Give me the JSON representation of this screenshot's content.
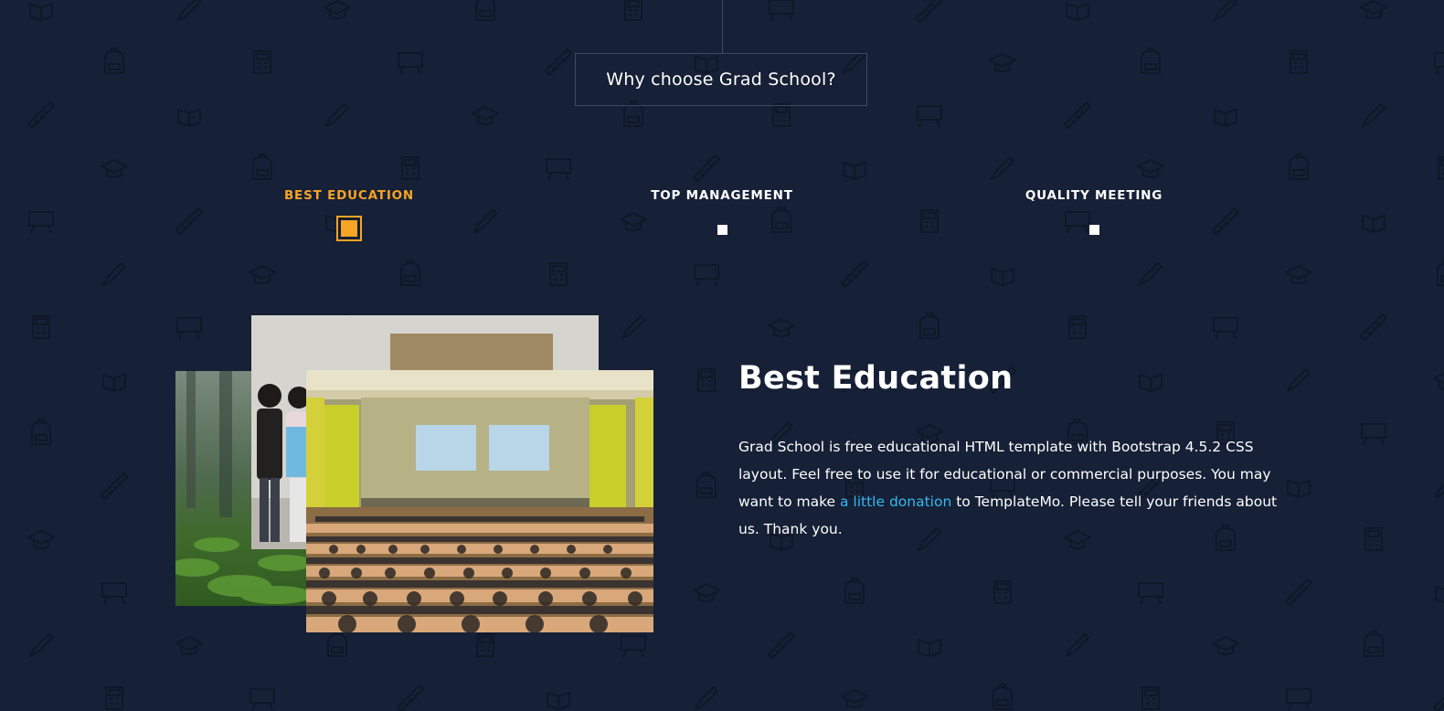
{
  "section": {
    "title": "Why choose Grad School?"
  },
  "tabs": [
    {
      "label": "BEST EDUCATION",
      "active": true
    },
    {
      "label": "TOP MANAGEMENT",
      "active": false
    },
    {
      "label": "QUALITY MEETING",
      "active": false
    }
  ],
  "content": {
    "title": "Best Education",
    "text_before_link": "Grad School is free educational HTML template with Bootstrap 4.5.2 CSS layout. Feel free to use it for educational or commercial purposes. You may want to make ",
    "link_text": "a little donation",
    "text_after_link": " to TemplateMo. Please tell your friends about us. Thank you."
  },
  "colors": {
    "background": "#162036",
    "accent": "#f5a425",
    "link": "#35b7f0",
    "text": "#ffffff",
    "border": "#3f4a62"
  },
  "icons": {
    "background_pattern": [
      "book-icon",
      "pencil-icon",
      "graduation-cap-icon",
      "backpack-icon",
      "calculator-icon",
      "chalkboard-icon",
      "ruler-icon"
    ]
  }
}
